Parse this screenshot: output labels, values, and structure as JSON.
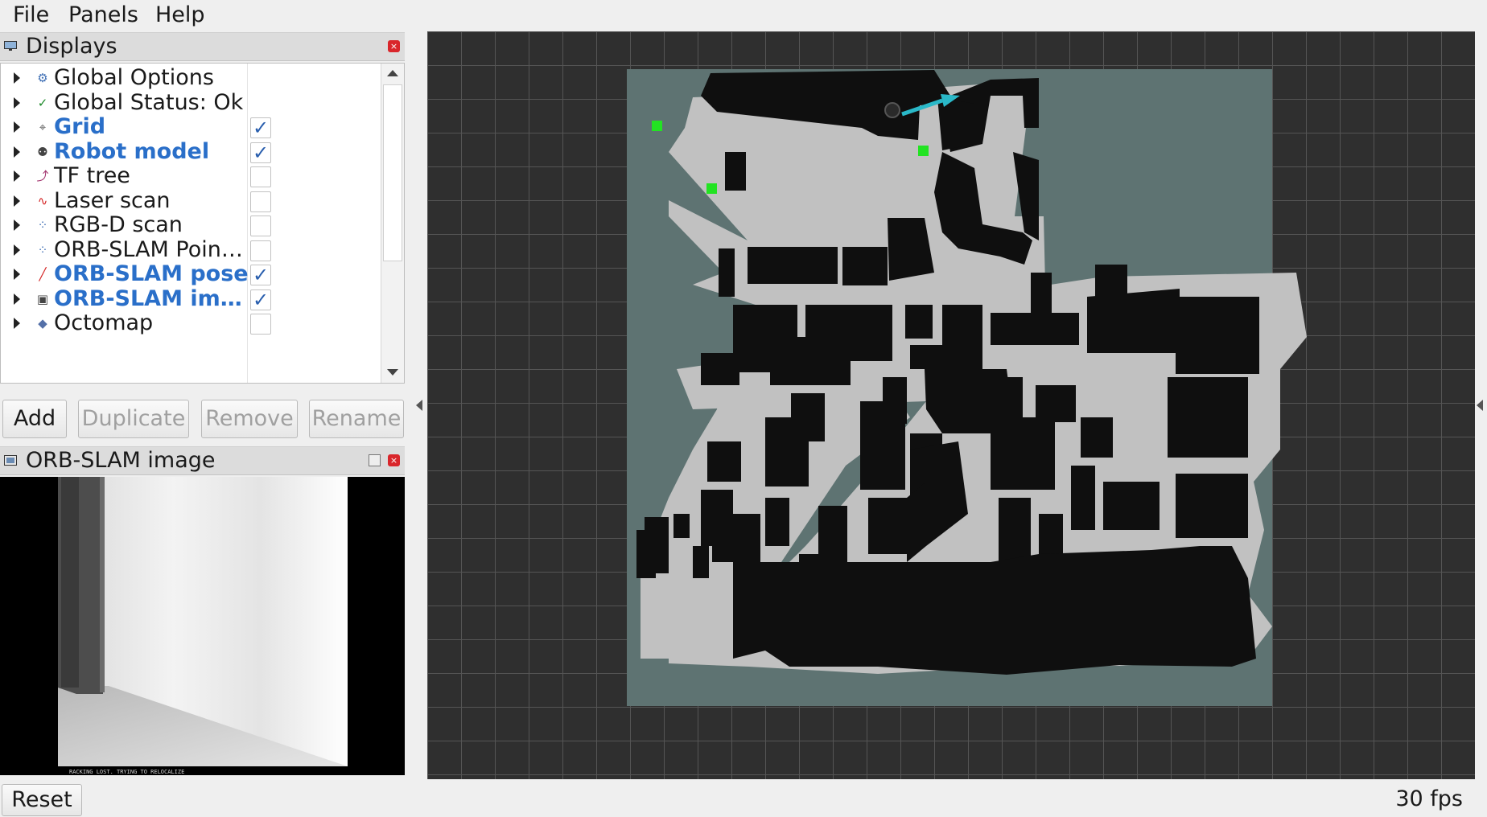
{
  "menu": {
    "file": "File",
    "panels": "Panels",
    "help": "Help"
  },
  "displays_panel": {
    "title": "Displays",
    "items": [
      {
        "label": "Global Options",
        "enabled": false,
        "has_checkbox": false,
        "icon": "gear-icon"
      },
      {
        "label": "Global Status: Ok",
        "enabled": false,
        "has_checkbox": false,
        "icon": "check-icon"
      },
      {
        "label": "Grid",
        "enabled": true,
        "has_checkbox": true,
        "checked": true,
        "icon": "grid-icon"
      },
      {
        "label": "Robot model",
        "enabled": true,
        "has_checkbox": true,
        "checked": true,
        "icon": "robot-icon"
      },
      {
        "label": "TF tree",
        "enabled": false,
        "has_checkbox": true,
        "checked": false,
        "icon": "tf-icon"
      },
      {
        "label": "Laser scan",
        "enabled": false,
        "has_checkbox": true,
        "checked": false,
        "icon": "laser-icon"
      },
      {
        "label": "RGB-D scan",
        "enabled": false,
        "has_checkbox": true,
        "checked": false,
        "icon": "pointcloud-icon"
      },
      {
        "label": "ORB-SLAM Poin…",
        "enabled": false,
        "has_checkbox": true,
        "checked": false,
        "icon": "pointcloud-icon"
      },
      {
        "label": "ORB-SLAM pose",
        "enabled": true,
        "has_checkbox": true,
        "checked": true,
        "icon": "pose-icon"
      },
      {
        "label": "ORB-SLAM im…",
        "enabled": true,
        "has_checkbox": true,
        "checked": true,
        "icon": "image-icon"
      },
      {
        "label": "Octomap",
        "enabled": false,
        "has_checkbox": true,
        "checked": false,
        "icon": "octomap-icon"
      }
    ],
    "check_glyph": "✓"
  },
  "buttons": {
    "add": "Add",
    "duplicate": "Duplicate",
    "remove": "Remove",
    "rename": "Rename"
  },
  "image_panel": {
    "title": "ORB-SLAM image",
    "overlay_text": "RACKING LOST. TRYING TO RELOCALIZE"
  },
  "status_bar": {
    "reset": "Reset",
    "fps": "30 fps"
  },
  "colors": {
    "enabled_label": "#2a6fc9",
    "map_unknown": "#5e7372",
    "map_free": "#c1c1c1",
    "map_occupied": "#0f0f0f",
    "landmark": "#22e322",
    "pose_arrow": "#2ab8c8"
  }
}
